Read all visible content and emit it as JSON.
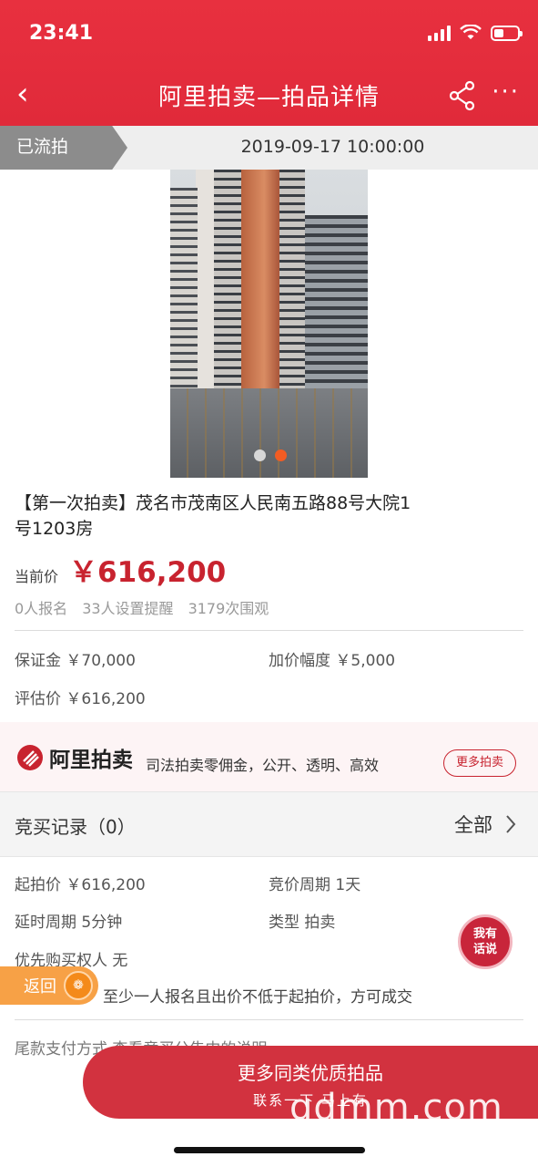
{
  "status_bar": {
    "time": "23:41"
  },
  "nav": {
    "back_glyph": "‹",
    "title": "阿里拍卖—拍品详情",
    "more_glyph": "···"
  },
  "auction_status": {
    "flag": "已流拍",
    "datetime": "2019-09-17 10:00:00"
  },
  "photo": {
    "count": 2,
    "current": 2
  },
  "item": {
    "title": "【第一次拍卖】茂名市茂南区人民南五路88号大院1号1203房",
    "current_price_label": "当前价",
    "current_price": "￥616,200",
    "stats": [
      "0人报名",
      "33人设置提醒",
      "3179次围观"
    ]
  },
  "fees": {
    "deposit": "保证金 ￥70,000",
    "increment": "加价幅度 ￥5,000",
    "appraisal": "评估价 ￥616,200"
  },
  "promo": {
    "logo_text": "阿里拍卖",
    "slogan": "司法拍卖零佣金，公开、透明、高效",
    "more_button": "更多拍卖"
  },
  "bid_records": {
    "title": "竞买记录（0）",
    "all_label": "全部"
  },
  "details": {
    "start_price": "起拍价 ￥616,200",
    "period": "竞价周期 1天",
    "delay": "延时周期 5分钟",
    "type": "类型 拍卖",
    "priority": "优先购买权人 无",
    "rule": "至少一人报名且出价不低于起拍价，方可成交",
    "partial_text": "尾款支付方式 查看竞买公告中的说明"
  },
  "fab": {
    "line1": "我有",
    "line2": "话说"
  },
  "back_pill": {
    "label": "返回"
  },
  "cta": {
    "title": "更多同类优质拍品",
    "subtitle": "联系一下 马上有"
  },
  "watermark": "gdmm.com",
  "colors": {
    "brand": "#e02a3a",
    "price": "#c8232f"
  }
}
